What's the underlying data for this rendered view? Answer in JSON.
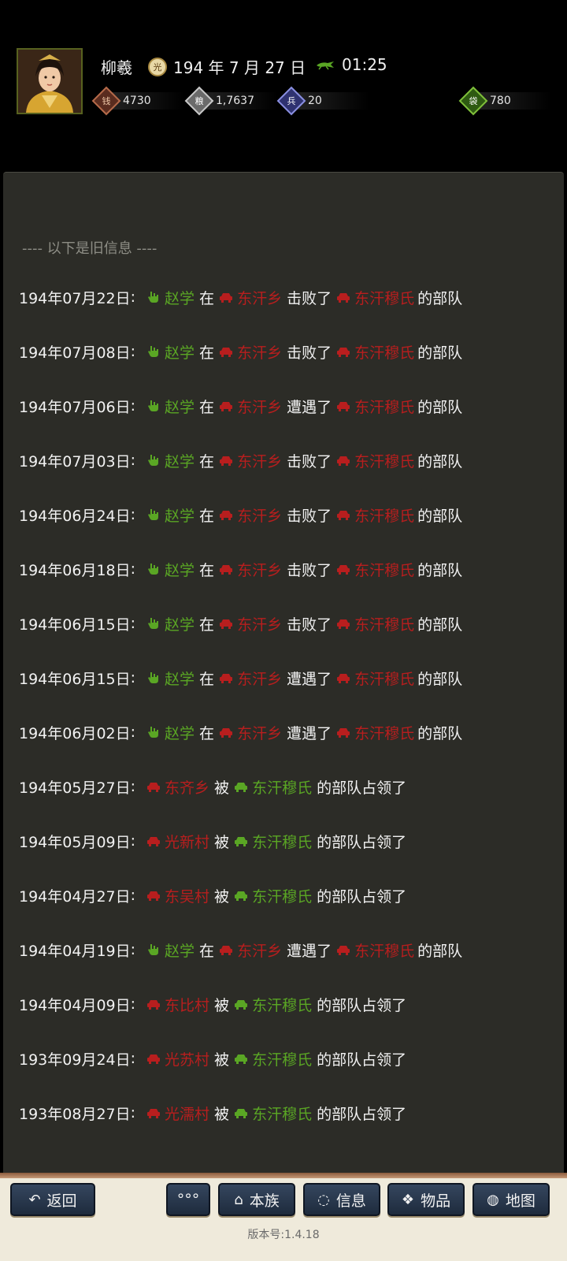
{
  "header": {
    "name": "柳羲",
    "date": "194 年 7 月 27 日",
    "time": "01:25",
    "resources": [
      {
        "icon": "coin-icon",
        "value": "4730",
        "color": "#8a3f2a"
      },
      {
        "icon": "grain-icon",
        "value": "1,7637",
        "color": "#9a9a9a"
      },
      {
        "icon": "soldier-icon",
        "value": "20",
        "color": "#4a4f9a"
      },
      {
        "icon": "money-bag-icon",
        "value": "780",
        "color": "#4c7a1e"
      }
    ]
  },
  "old_info_label": "---- 以下是旧信息 ----",
  "entries": [
    {
      "date": "194年07月22日",
      "sep": ":",
      "type": "battle",
      "a": "赵学",
      "w1": "在",
      "b": "东汗乡",
      "w2": "击败了",
      "c": "东汗穆氏",
      "w3": "的部队"
    },
    {
      "date": "194年07月08日",
      "sep": ":",
      "type": "battle",
      "a": "赵学",
      "w1": "在",
      "b": "东汗乡",
      "w2": "击败了",
      "c": "东汗穆氏",
      "w3": "的部队"
    },
    {
      "date": "194年07月06日",
      "sep": ":",
      "type": "battle",
      "a": "赵学",
      "w1": "在",
      "b": "东汗乡",
      "w2": "遭遇了",
      "c": "东汗穆氏",
      "w3": "的部队"
    },
    {
      "date": "194年07月03日",
      "sep": ":",
      "type": "battle",
      "a": "赵学",
      "w1": "在",
      "b": "东汗乡",
      "w2": "击败了",
      "c": "东汗穆氏",
      "w3": "的部队"
    },
    {
      "date": "194年06月24日",
      "sep": ":",
      "type": "battle",
      "a": "赵学",
      "w1": "在",
      "b": "东汗乡",
      "w2": "击败了",
      "c": "东汗穆氏",
      "w3": "的部队"
    },
    {
      "date": "194年06月18日",
      "sep": ":",
      "type": "battle",
      "a": "赵学",
      "w1": "在",
      "b": "东汗乡",
      "w2": "击败了",
      "c": "东汗穆氏",
      "w3": "的部队"
    },
    {
      "date": "194年06月15日",
      "sep": ":",
      "type": "battle",
      "a": "赵学",
      "w1": "在",
      "b": "东汗乡",
      "w2": "击败了",
      "c": "东汗穆氏",
      "w3": "的部队"
    },
    {
      "date": "194年06月15日",
      "sep": ":",
      "type": "battle",
      "a": "赵学",
      "w1": "在",
      "b": "东汗乡",
      "w2": "遭遇了",
      "c": "东汗穆氏",
      "w3": "的部队"
    },
    {
      "date": "194年06月02日",
      "sep": ":",
      "type": "battle",
      "a": "赵学",
      "w1": "在",
      "b": "东汗乡",
      "w2": "遭遇了",
      "c": "东汗穆氏",
      "w3": "的部队"
    },
    {
      "date": "194年05月27日",
      "sep": ":",
      "type": "capture",
      "a": "东齐乡",
      "w1": "被",
      "b": "东汗穆氏",
      "w2": "的部队占领了"
    },
    {
      "date": "194年05月09日",
      "sep": ":",
      "type": "capture",
      "a": "光新村",
      "w1": "被",
      "b": "东汗穆氏",
      "w2": "的部队占领了"
    },
    {
      "date": "194年04月27日",
      "sep": ":",
      "type": "capture",
      "a": "东吴村",
      "w1": "被",
      "b": "东汗穆氏",
      "w2": "的部队占领了"
    },
    {
      "date": "194年04月19日",
      "sep": ":",
      "type": "battle",
      "a": "赵学",
      "w1": "在",
      "b": "东汗乡",
      "w2": "遭遇了",
      "c": "东汗穆氏",
      "w3": "的部队"
    },
    {
      "date": "194年04月09日",
      "sep": ":",
      "type": "capture",
      "a": "东比村",
      "w1": "被",
      "b": "东汗穆氏",
      "w2": "的部队占领了"
    },
    {
      "date": "193年09月24日",
      "sep": ":",
      "type": "capture",
      "a": "光苏村",
      "w1": "被",
      "b": "东汗穆氏",
      "w2": "的部队占领了"
    },
    {
      "date": "193年08月27日",
      "sep": ":",
      "type": "capture",
      "a": "光濡村",
      "w1": "被",
      "b": "东汗穆氏",
      "w2": "的部队占领了"
    }
  ],
  "buttons": {
    "back": "返回",
    "more": "°°°",
    "clan": "本族",
    "info": "信息",
    "items": "物品",
    "map": "地图"
  },
  "version": "版本号:1.4.18",
  "colors": {
    "ally": "#5aa624",
    "enemy": "#b81e1e",
    "panel": "#2c2c27"
  }
}
